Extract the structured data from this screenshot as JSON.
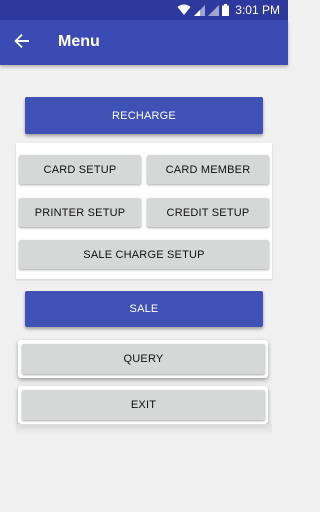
{
  "status_bar": {
    "time": "3:01 PM",
    "icons": [
      "wifi-icon",
      "signal-icon",
      "signal-icon",
      "battery-icon"
    ]
  },
  "app_bar": {
    "back_icon": "arrow-left-icon",
    "title": "Menu"
  },
  "menu": {
    "recharge": "RECHARGE",
    "card_setup": "CARD SETUP",
    "card_member": "CARD MEMBER",
    "printer_setup": "PRINTER SETUP",
    "credit_setup": "CREDIT SETUP",
    "sale_charge_setup": "SALE CHARGE SETUP",
    "sale": "SALE",
    "query": "QUERY",
    "exit": "EXIT"
  },
  "colors": {
    "status_bar": "#2e399e",
    "app_bar": "#3c4bb3",
    "primary_button": "#3f51b5",
    "secondary_button": "#d6d7d7",
    "background": "#f0f0f0"
  }
}
